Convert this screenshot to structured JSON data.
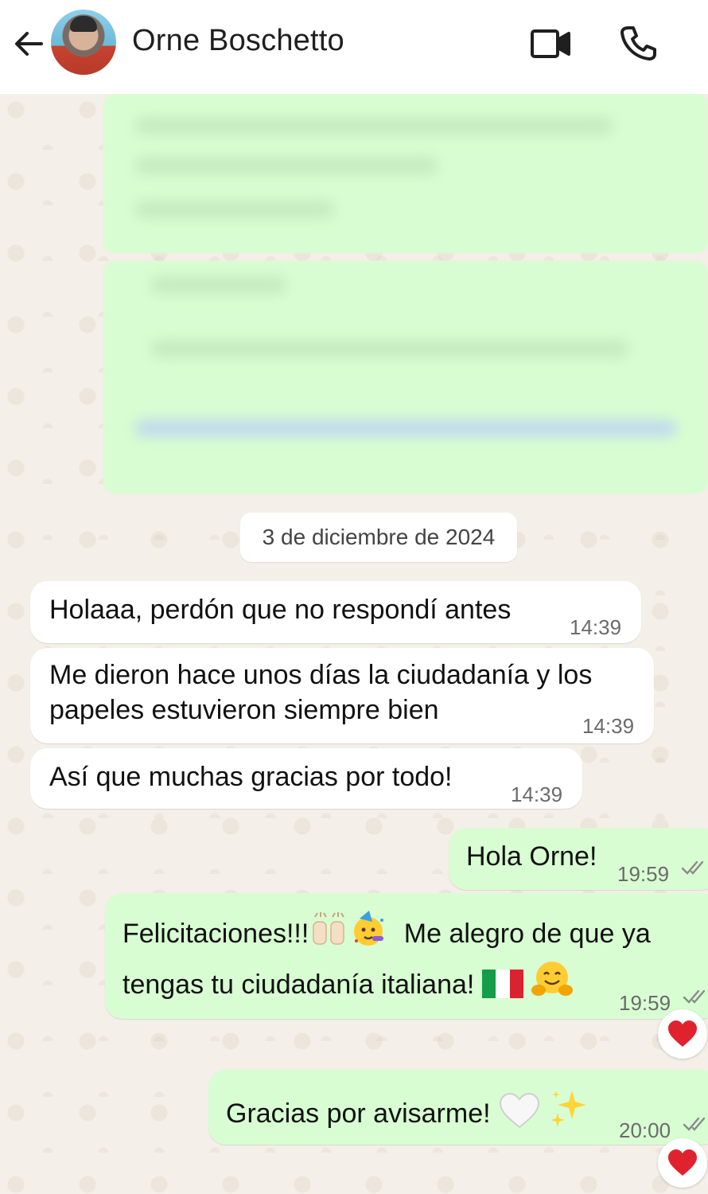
{
  "header": {
    "contact_name": "Orne Boschetto",
    "icons": [
      "back-arrow-icon",
      "avatar",
      "video-call-icon",
      "voice-call-icon"
    ]
  },
  "date_separator": "3 de diciembre de 2024",
  "messages": [
    {
      "direction": "incoming",
      "text": "Holaaa, perdón que no respondí antes",
      "time": "14:39"
    },
    {
      "direction": "incoming",
      "text_line1": "Me dieron hace unos días la ciudadanía y los",
      "text_line2": "papeles estuvieron siempre bien",
      "time": "14:39"
    },
    {
      "direction": "incoming",
      "text": "Así que muchas gracias por todo!",
      "time": "14:39"
    },
    {
      "direction": "outgoing",
      "text": "Hola Orne!",
      "time": "19:59",
      "status": "read"
    },
    {
      "direction": "outgoing",
      "text_line1_a": "Felicitaciones!!!",
      "text_line1_b": "Me alegro de que ya",
      "text_line2": "tengas tu ciudadanía italiana!",
      "time": "19:59",
      "status": "read",
      "reaction": "red-heart"
    },
    {
      "direction": "outgoing",
      "text": "Gracias por avisarme!",
      "time": "20:00",
      "status": "read",
      "reaction": "red-heart"
    }
  ],
  "colors": {
    "incoming_bubble": "#ffffff",
    "outgoing_bubble": "#d8fdd2",
    "wallpaper": "#f4efe8",
    "heart": "#e0222e"
  }
}
